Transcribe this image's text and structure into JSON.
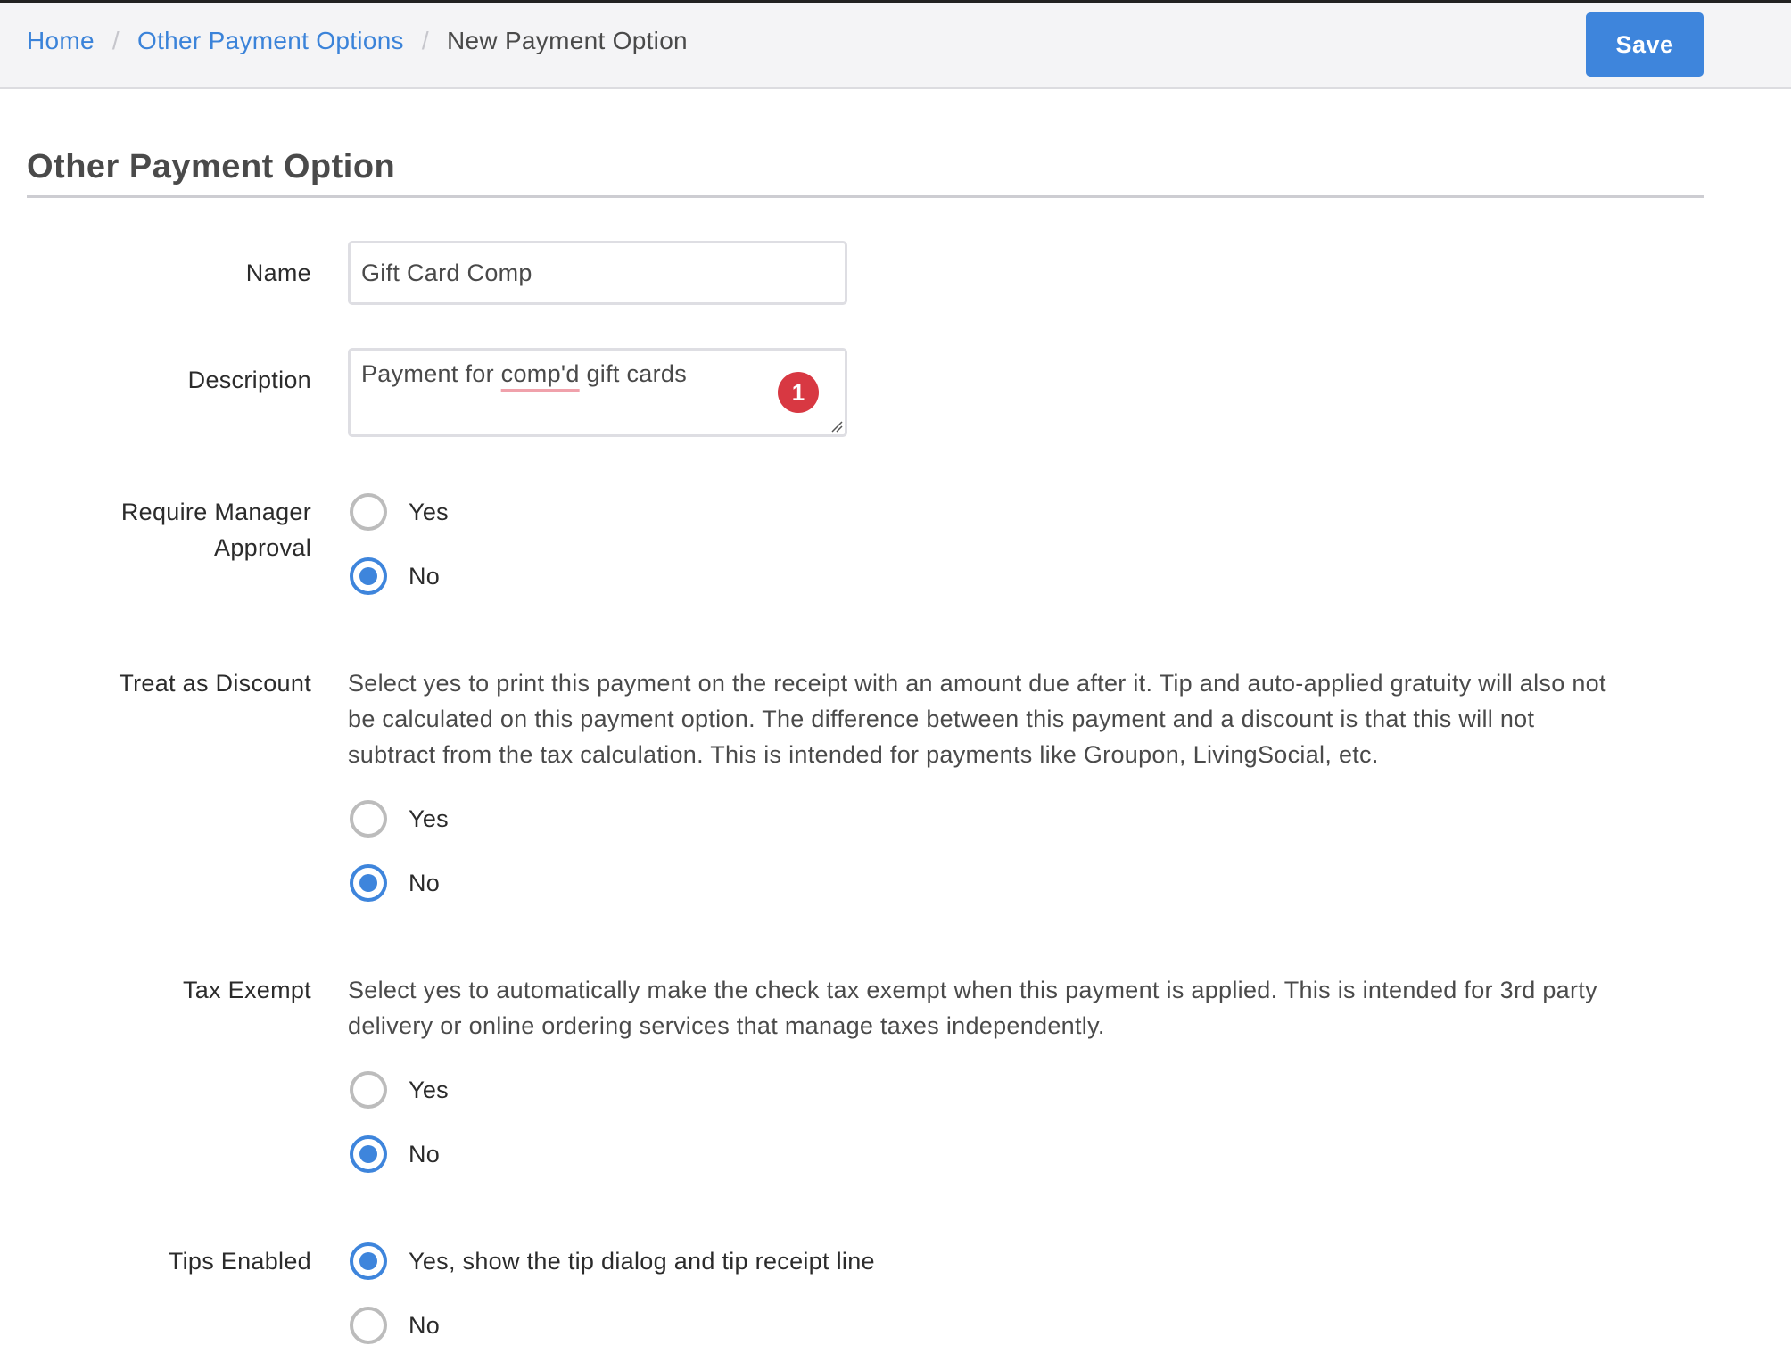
{
  "header": {
    "breadcrumb": [
      {
        "label": "Home",
        "link": true
      },
      {
        "label": "Other Payment Options",
        "link": true
      },
      {
        "label": "New Payment Option",
        "link": false
      }
    ],
    "separator": "/",
    "save_label": "Save"
  },
  "page": {
    "title": "Other Payment Option"
  },
  "form": {
    "name": {
      "label": "Name",
      "value": "Gift Card Comp"
    },
    "description": {
      "label": "Description",
      "value": "Payment for comp'd gift cards",
      "value_before": "Payment for ",
      "misspelled_word": "comp'd",
      "value_after": " gift cards",
      "error_count": "1"
    },
    "require_manager_approval": {
      "label_line1": "Require Manager",
      "label_line2": "Approval",
      "options": [
        {
          "label": "Yes",
          "checked": false
        },
        {
          "label": "No",
          "checked": true
        }
      ]
    },
    "treat_as_discount": {
      "label": "Treat as Discount",
      "help_line1": "Select yes to print this payment on the receipt with an amount due after it. Tip and auto-applied gratuity will also not",
      "help_line2": "be calculated on this payment option. The difference between this payment and a discount is that this will not",
      "help_line3": "subtract from the tax calculation. This is intended for payments like Groupon, LivingSocial, etc.",
      "options": [
        {
          "label": "Yes",
          "checked": false
        },
        {
          "label": "No",
          "checked": true
        }
      ]
    },
    "tax_exempt": {
      "label": "Tax Exempt",
      "help_line1": "Select yes to automatically make the check tax exempt when this payment is applied. This is intended for 3rd party",
      "help_line2": "delivery or online ordering services that manage taxes independently.",
      "options": [
        {
          "label": "Yes",
          "checked": false
        },
        {
          "label": "No",
          "checked": true
        }
      ]
    },
    "tips_enabled": {
      "label": "Tips Enabled",
      "options": [
        {
          "label": "Yes, show the tip dialog and tip receipt line",
          "checked": true
        },
        {
          "label": "No",
          "checked": false
        }
      ]
    }
  },
  "colors": {
    "accent": "#3e85dc",
    "link": "#3b83d9",
    "error_badge": "#d83842",
    "header_bg": "#f4f4f6"
  }
}
